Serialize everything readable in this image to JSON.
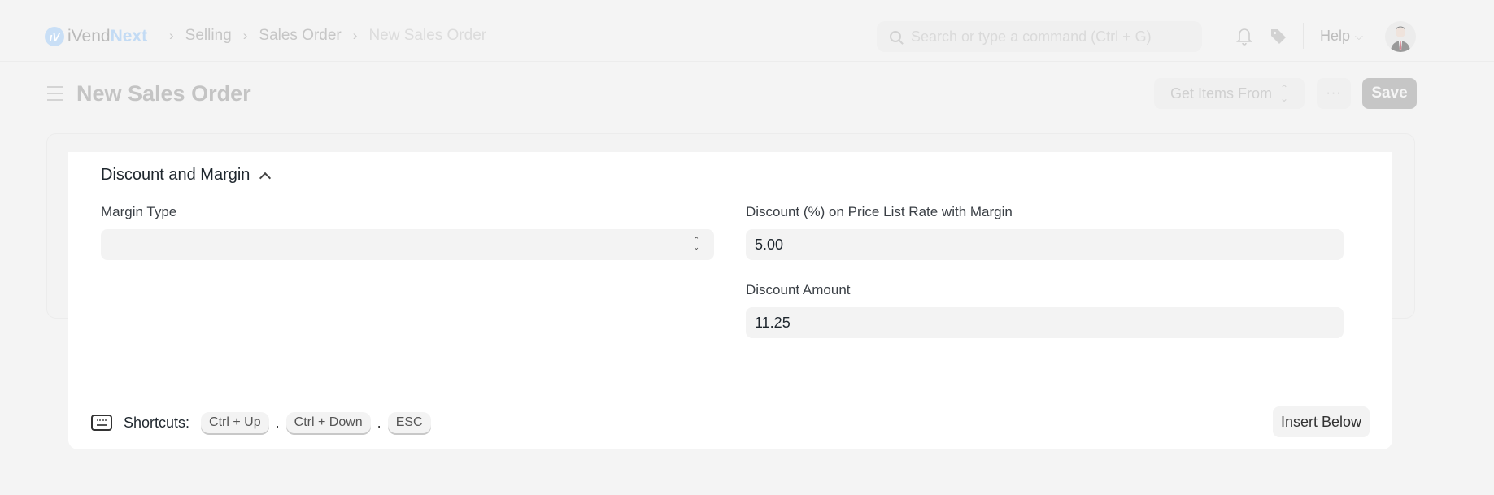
{
  "navbar": {
    "brand_prefix": "iVend",
    "brand_suffix": "Next",
    "breadcrumbs": [
      "Selling",
      "Sales Order",
      "New Sales Order"
    ],
    "search_placeholder": "Search or type a command (Ctrl + G)",
    "help_label": "Help",
    "icons": [
      "notification-bell-icon",
      "tag-icon",
      "user-avatar"
    ]
  },
  "page": {
    "title": "New Sales Order",
    "get_items_label": "Get Items From",
    "more_label": "···",
    "save_label": "Save"
  },
  "row_editor": {
    "section_title": "Discount and Margin",
    "fields": {
      "margin_type": {
        "label": "Margin Type",
        "value": ""
      },
      "discount_percentage": {
        "label": "Discount (%) on Price List Rate with Margin",
        "value": "5.00"
      },
      "discount_amount": {
        "label": "Discount Amount",
        "value": "11.25"
      }
    },
    "shortcuts_label": "Shortcuts:",
    "shortcuts": [
      "Ctrl + Up",
      "Ctrl + Down",
      "ESC"
    ],
    "shortcut_separator": ".",
    "insert_below_label": "Insert Below"
  }
}
